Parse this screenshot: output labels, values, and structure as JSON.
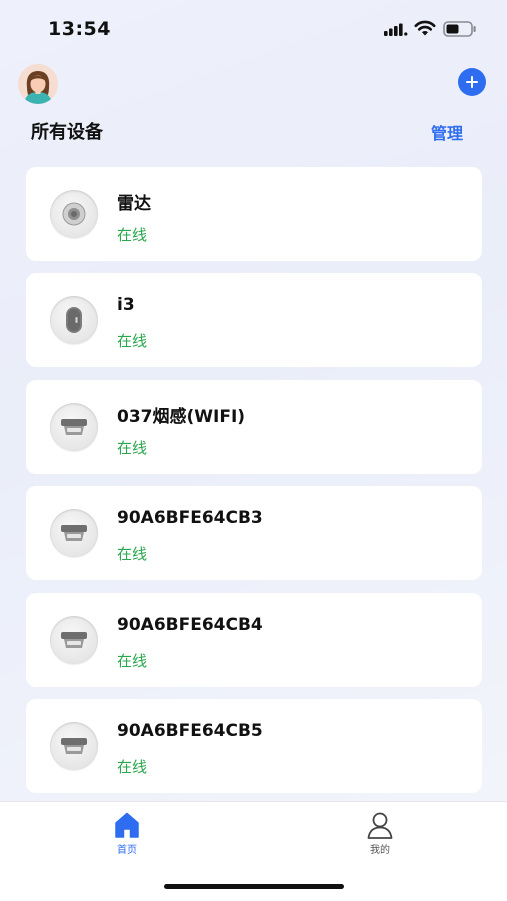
{
  "status_bar": {
    "time": "13:54"
  },
  "header": {
    "section_title": "所有设备",
    "manage_label": "管理"
  },
  "devices": [
    {
      "name": "雷达",
      "status": "在线",
      "icon": "radar-icon"
    },
    {
      "name": "i3",
      "status": "在线",
      "icon": "door-lock-icon"
    },
    {
      "name": "037烟感(WIFI)",
      "status": "在线",
      "icon": "smoke-detector-icon"
    },
    {
      "name": "90A6BFE64CB3",
      "status": "在线",
      "icon": "smoke-detector-icon"
    },
    {
      "name": "90A6BFE64CB4",
      "status": "在线",
      "icon": "smoke-detector-icon"
    },
    {
      "name": "90A6BFE64CB5",
      "status": "在线",
      "icon": "smoke-detector-icon"
    }
  ],
  "tabs": [
    {
      "label": "首页",
      "icon": "home-icon",
      "active": true
    },
    {
      "label": "我的",
      "icon": "person-icon",
      "active": false
    }
  ],
  "colors": {
    "accent": "#2f6df0",
    "online": "#2aa64e"
  }
}
